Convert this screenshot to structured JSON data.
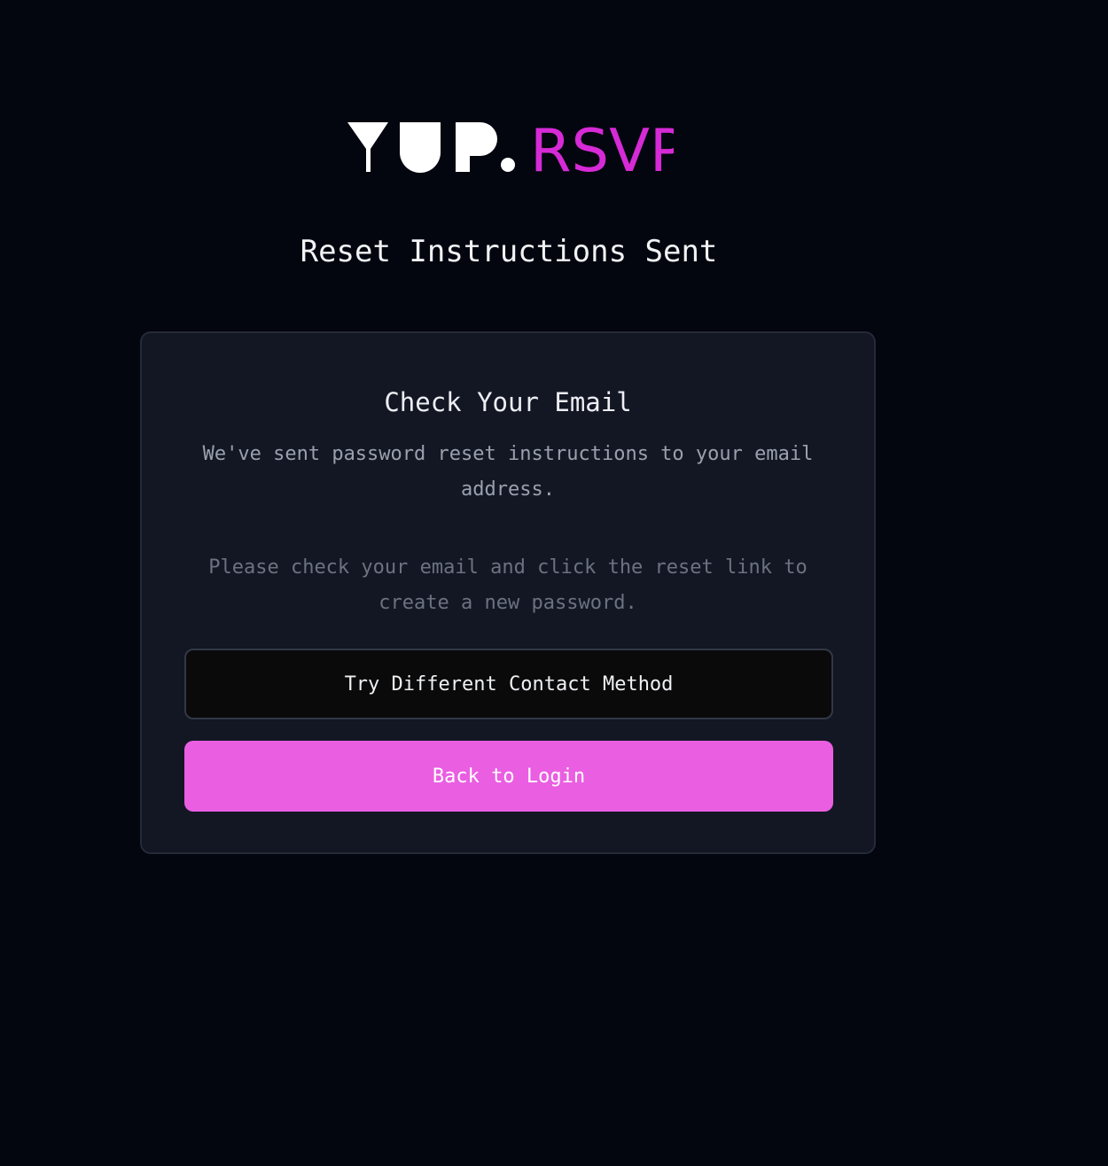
{
  "brand": {
    "logo_primary": "YUP.",
    "logo_secondary": "RSVP",
    "primary_color": "#ffffff",
    "accent_color": "#d62ad6"
  },
  "page_title": "Reset Instructions Sent",
  "card": {
    "title": "Check Your Email",
    "message": "We've sent password reset instructions to your email address.",
    "instructions": "Please check your email and click the reset link to create a new password."
  },
  "buttons": {
    "alternate_label": "Try Different Contact Method",
    "back_label": "Back to Login",
    "back_color": "#ea5ee2"
  }
}
